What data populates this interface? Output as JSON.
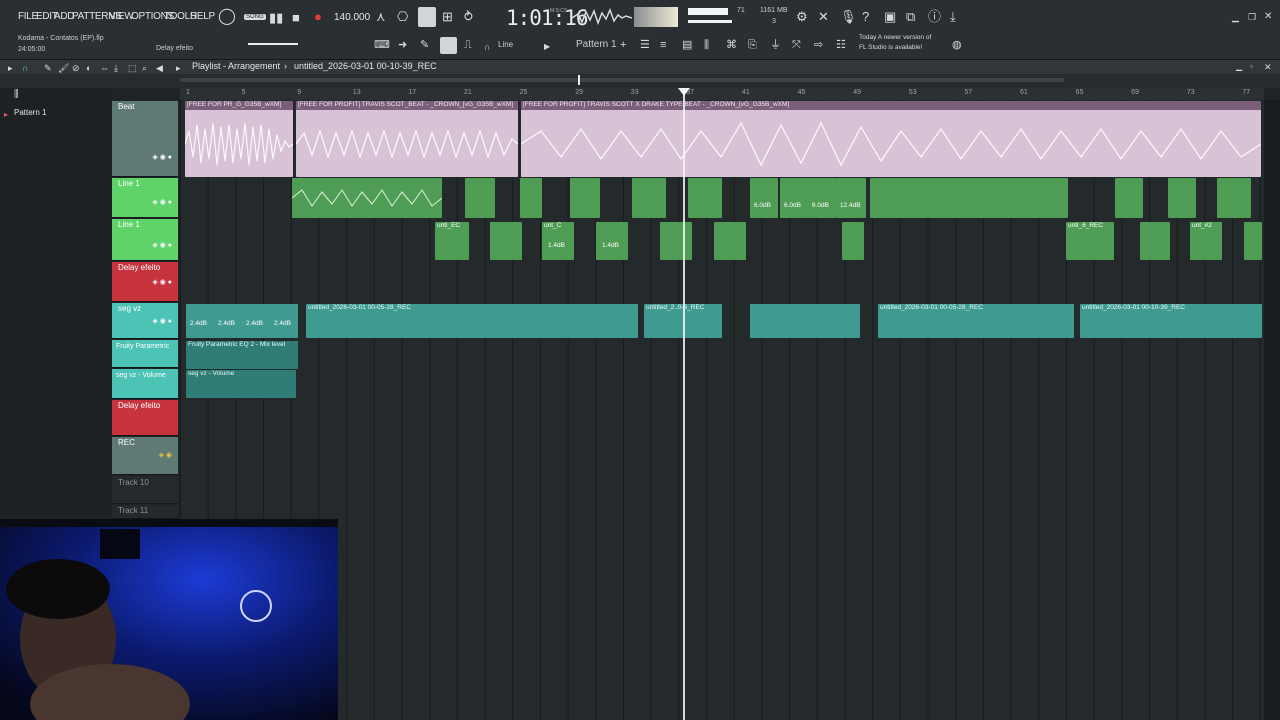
{
  "menu": [
    "FILE",
    "EDIT",
    "ADD",
    "PATTERNS",
    "VIEW",
    "OPTIONS",
    "TOOLS",
    "HELP"
  ],
  "transport": {
    "song_label": "SONG",
    "tempo": "140.000",
    "time": "1:01:16",
    "time_unit": "M:S:CS"
  },
  "monitor": {
    "cpu": "71",
    "memory": "1161 MB",
    "voices": "3"
  },
  "project": {
    "name": "Kodama - Contatos (EP).flp",
    "duration": "24:05:00",
    "hint_label": "Delay efeito"
  },
  "toolbar2": {
    "snap": "Line",
    "pattern": "Pattern 1"
  },
  "news": {
    "line1": "Today  A newer version of",
    "line2": "FL Studio is available!"
  },
  "playlist": {
    "title": "Playlist - Arrangement",
    "separator": "›",
    "arrangement": "untitled_2026-03-01 00-10-39_REC"
  },
  "browser": {
    "pattern_item": "Pattern 1"
  },
  "ruler": [
    "1",
    "5",
    "9",
    "13",
    "17",
    "21",
    "25",
    "29",
    "33",
    "37",
    "41",
    "45",
    "49",
    "53",
    "57",
    "61",
    "65",
    "69",
    "73",
    "77"
  ],
  "tracks": [
    {
      "name": "Beat",
      "color": "#5f7a74"
    },
    {
      "name": "Line 1",
      "color": "#5fd36a"
    },
    {
      "name": "Line 1",
      "color": "#5fd36a"
    },
    {
      "name": "Delay efeito",
      "color": "#c7343e"
    },
    {
      "name": "seg vz",
      "color": "#4cc3b5"
    },
    {
      "name": "Fruity Parametric",
      "color": "#4cc3b5"
    },
    {
      "name": "seg vz - Volume",
      "color": "#4cc3b5"
    },
    {
      "name": "Delay efeito",
      "color": "#c7343e"
    },
    {
      "name": "REC",
      "color": "#5f7a74"
    },
    {
      "name": "Track 10",
      "color": ""
    },
    {
      "name": "Track 11",
      "color": ""
    }
  ],
  "clips": {
    "beat": [
      "[FREE FOR PR_G_G35B_wXM]",
      "[FREE FOR PROFIT] TRAVIS SCOT_BEAT - _CROWN_[vG_G35B_wXM]",
      "[FREE FOR PROFIT] TRAVIS SCOTT X DRAKE TYPE BEAT - _CROWN_[vG_G35B_wXM]"
    ],
    "line1_gain": [
      "6.0dB",
      "6.0dB",
      "6.0dB",
      "12.4dB"
    ],
    "line2_gain": [
      "1.4dB",
      "1.4dB"
    ],
    "line2_labels": [
      "unti_EC",
      "unt_C",
      "unti_6_REC",
      "unt_#2"
    ],
    "segvz": [
      "2.4dB",
      "2.4dB",
      "2.4dB",
      "2.4dB"
    ],
    "segvz_rec": [
      "untitled_2026-03-01 00-05-28_REC",
      "untitled_2026-03-01 00-05-28_REC",
      "untitled_2026-03-01 00-10-39_REC",
      "untitled_2..0-5_REC"
    ],
    "eq_clip": "Fruity Parametric EQ 2 - Mix level",
    "vol_clip": "seg vz - Volume"
  }
}
